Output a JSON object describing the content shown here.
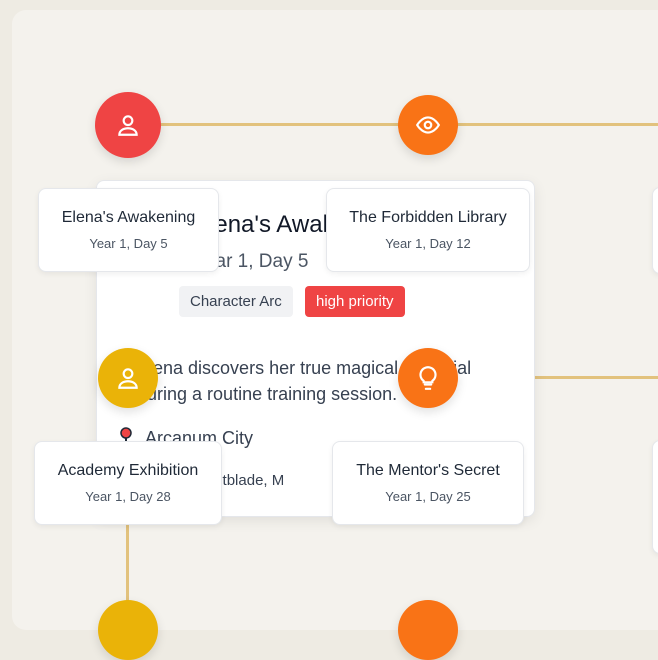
{
  "timeline": {
    "events": [
      {
        "title": "Elena's Awakening",
        "date": "Year 1, Day 5",
        "icon": "person-icon",
        "color": "#ef4444"
      },
      {
        "title": "The Forbidden Library",
        "date": "Year 1, Day 12",
        "icon": "eye-icon",
        "color": "#f97316"
      },
      {
        "title": "Academy Exhibition",
        "date": "Year 1, Day 28",
        "icon": "person-icon",
        "color": "#eab308"
      },
      {
        "title": "The Mentor's Secret",
        "date": "Year 1, Day 25",
        "icon": "lightbulb-icon",
        "color": "#f97316"
      }
    ],
    "line_color": "#e2c27d"
  },
  "detail": {
    "title": "Elena's Awakening",
    "date": "Year 1, Day 5",
    "category": "Character Arc",
    "priority": "high priority",
    "priority_color": "#ef4444",
    "description": "Elena discovers her true magical potential during a routine training session.",
    "location": "Arcanum City",
    "characters": "Elena Brightblade, M"
  }
}
